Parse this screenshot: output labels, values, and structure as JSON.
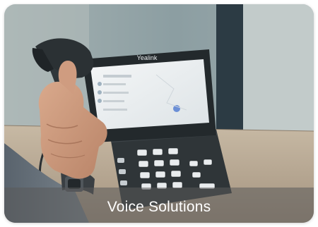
{
  "card": {
    "caption": "Voice Solutions",
    "brand_on_phone": "Yealink",
    "image_subject": "hand-lifting-desk-phone-handset"
  },
  "colors": {
    "caption_bar": "#5a5a5a",
    "caption_text": "#ffffff",
    "phone_body": "#2f3538",
    "desk": "#b9ab98",
    "wall": "#8fa2a6"
  }
}
